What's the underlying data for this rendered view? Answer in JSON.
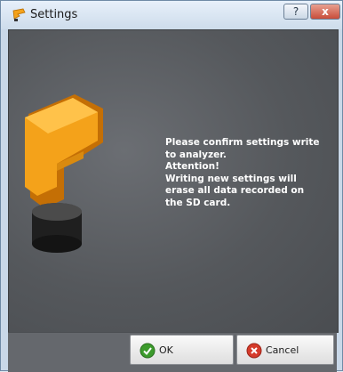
{
  "window": {
    "title": "Settings",
    "help_label": "?",
    "close_label": "x"
  },
  "message": {
    "text": "Please confirm settings write\nto analyzer.\n Attention!\nWriting new settings will\nerase all data recorded on\nthe SD card."
  },
  "buttons": {
    "ok_label": "OK",
    "cancel_label": "Cancel"
  },
  "icons": {
    "app": "app-logo-icon",
    "ok": "check-icon",
    "cancel": "cancel-icon"
  },
  "colors": {
    "logo_orange": "#f4a21a",
    "ok_green": "#3c9b2c",
    "cancel_red": "#d53b2b"
  }
}
